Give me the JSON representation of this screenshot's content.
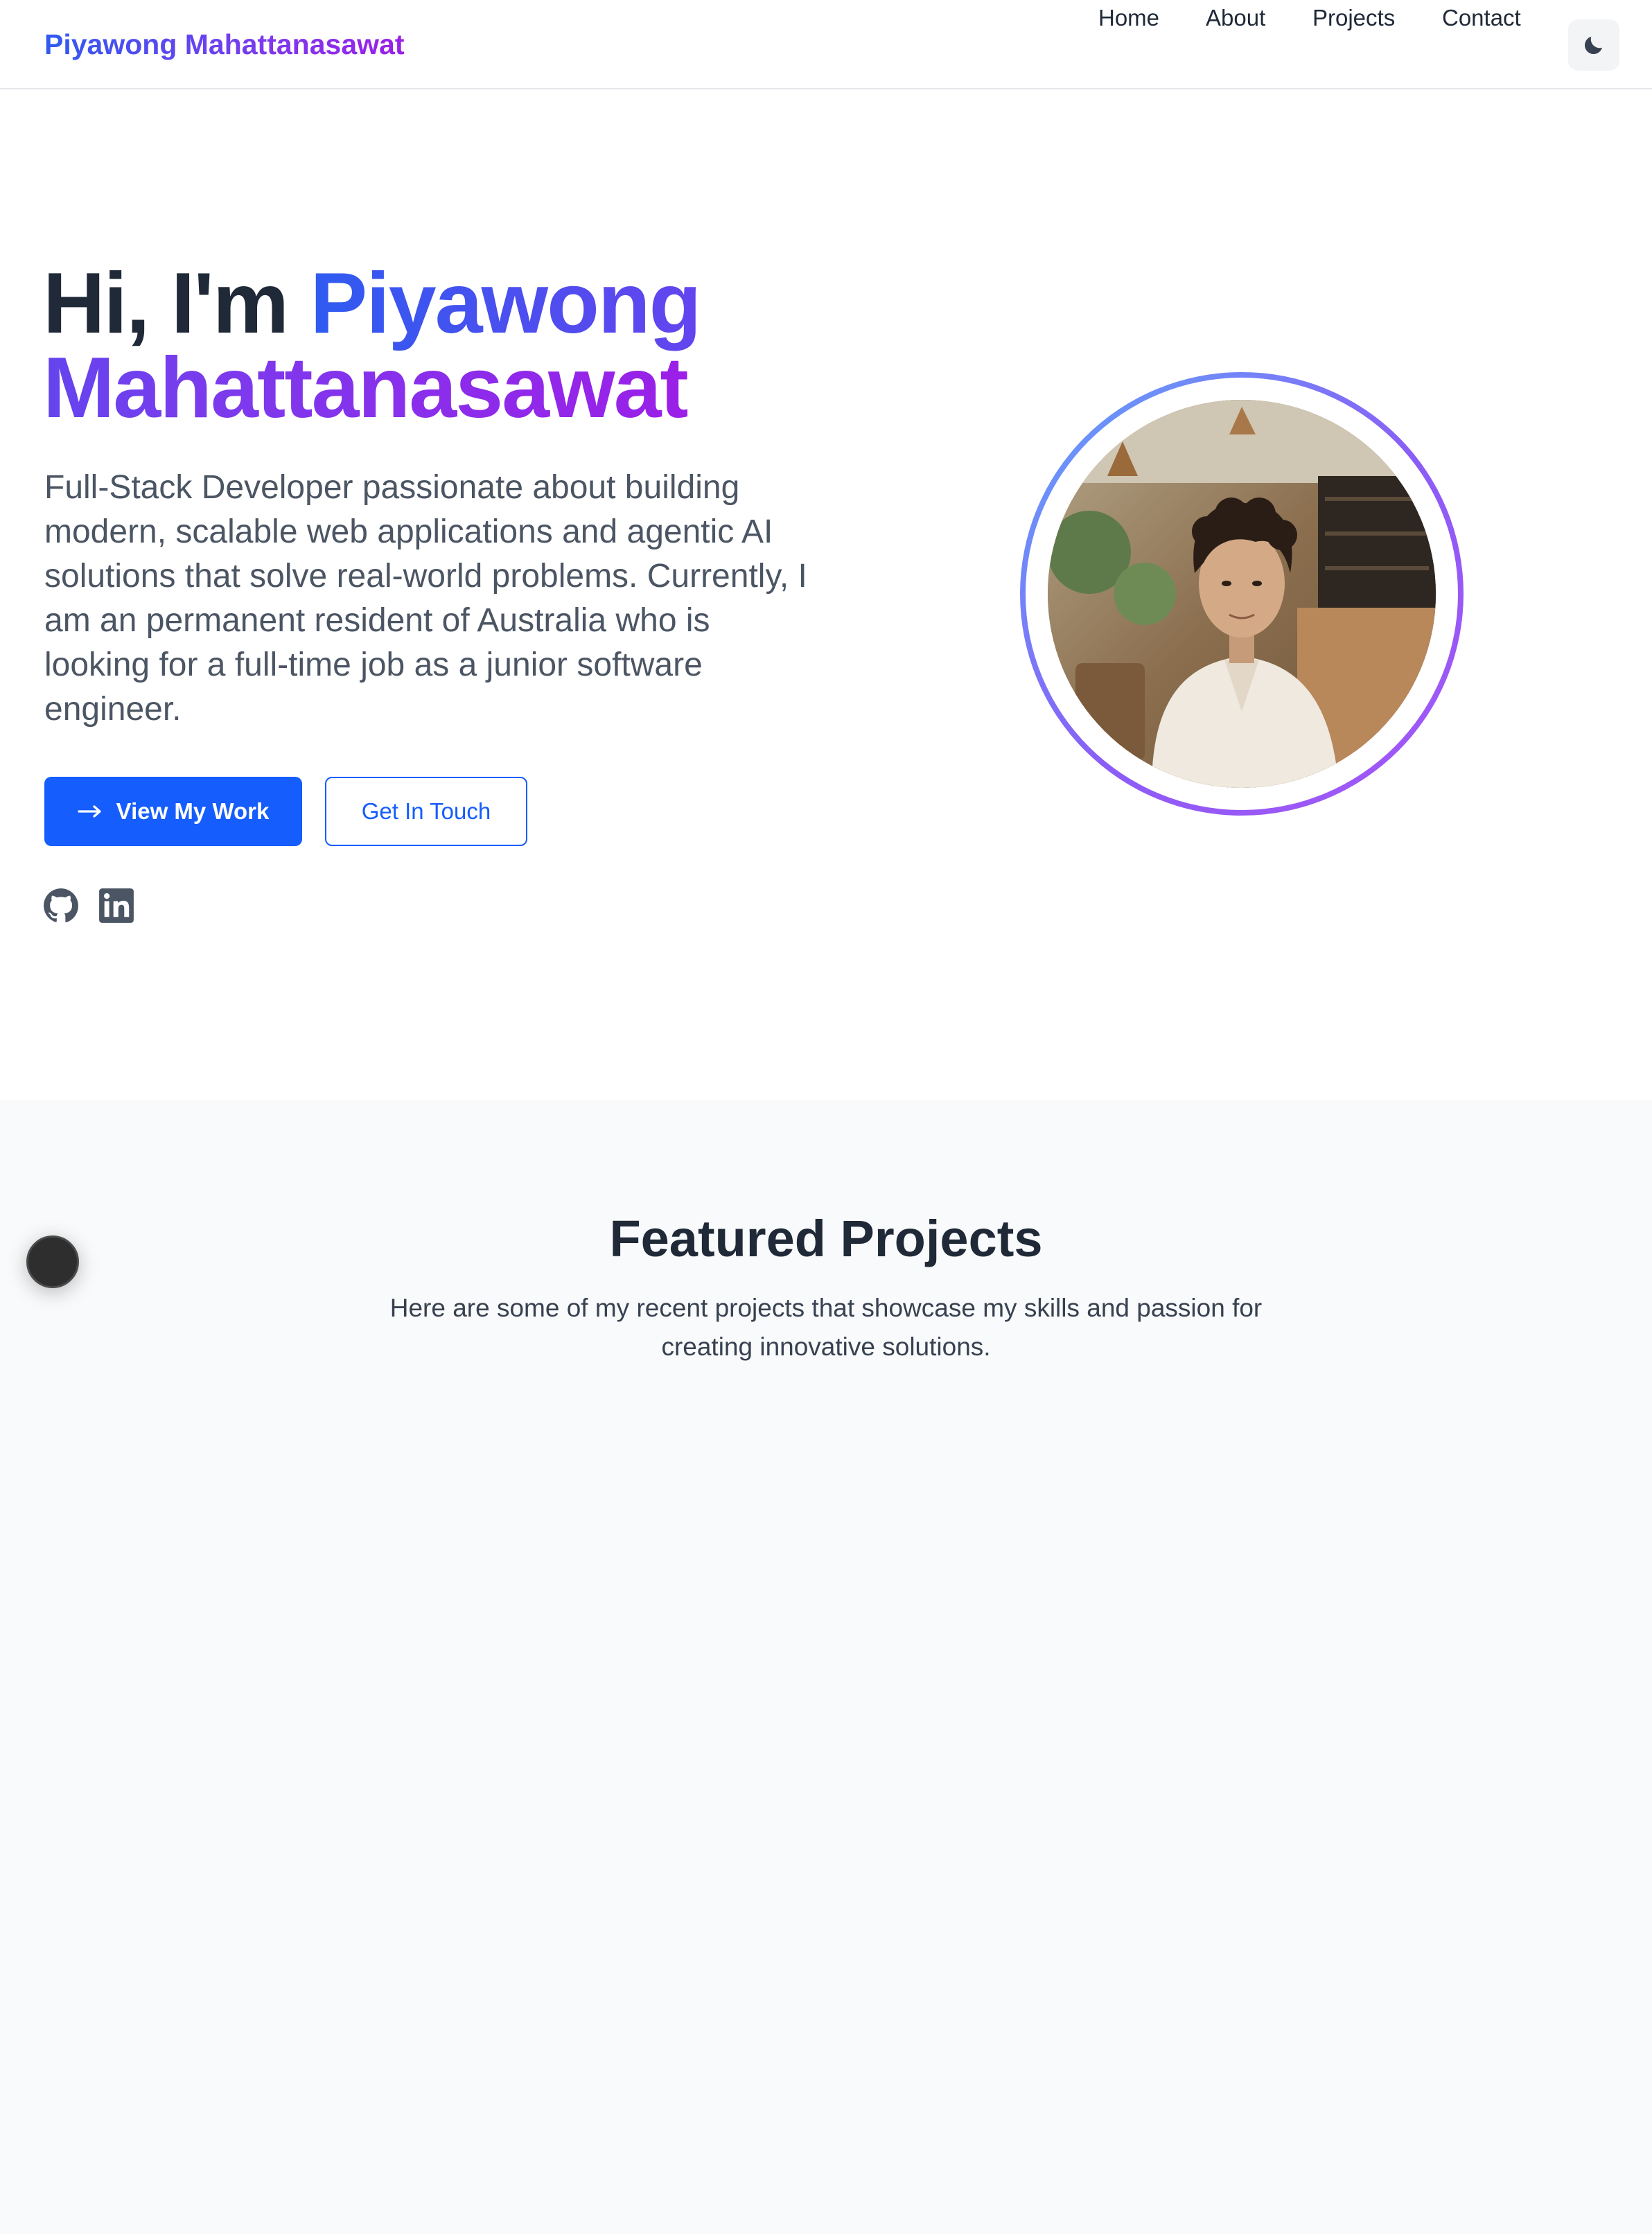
{
  "nav": {
    "brand": "Piyawong Mahattanasawat",
    "links": [
      "Home",
      "About",
      "Projects",
      "Contact"
    ],
    "theme_toggle_icon": "moon-icon"
  },
  "hero": {
    "greeting": "Hi, I'm ",
    "name": "Piyawong Mahattanasawat",
    "description": "Full-Stack Developer passionate about building modern, scalable web applications and agentic AI solutions that solve real-world problems. Currently, I am an permanent resident of Australia who is looking for a full-time job as a junior software engineer.",
    "primary_button": "View My Work",
    "primary_button_icon": "arrow-right-icon",
    "secondary_button": "Get In Touch",
    "social_icons": [
      "github-icon",
      "linkedin-icon"
    ]
  },
  "projects": {
    "title": "Featured Projects",
    "subtitle": "Here are some of my recent projects that showcase my skills and passion for creating innovative solutions."
  },
  "colors": {
    "primary": "#155dfc",
    "gradient_start": "#2f5bf0",
    "gradient_end": "#9b1fe8",
    "text_dark": "#1f2937",
    "section_bg": "#f9fafb"
  }
}
